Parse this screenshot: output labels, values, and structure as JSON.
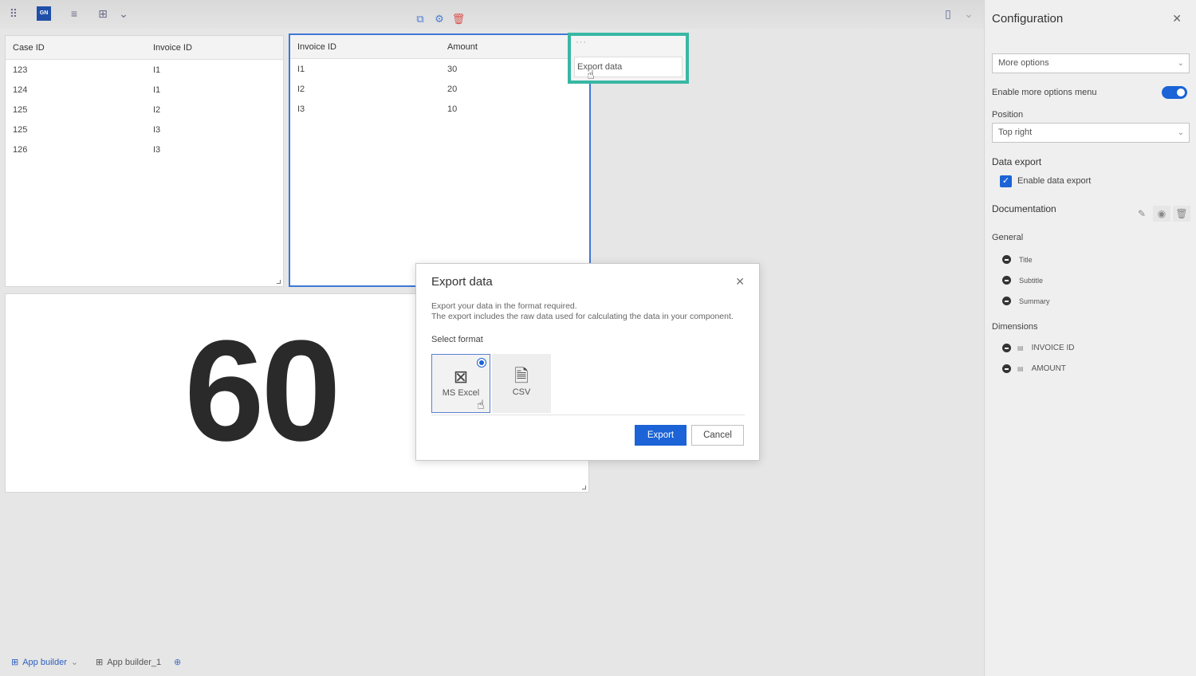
{
  "toolbar": {
    "badge_text": "GN"
  },
  "table1": {
    "headers": [
      "Case ID",
      "Invoice ID"
    ],
    "rows": [
      [
        "123",
        "I1"
      ],
      [
        "124",
        "I1"
      ],
      [
        "125",
        "I2"
      ],
      [
        "125",
        "I3"
      ],
      [
        "126",
        "I3"
      ]
    ]
  },
  "table2": {
    "headers": [
      "Invoice ID",
      "Amount"
    ],
    "rows": [
      [
        "I1",
        "30"
      ],
      [
        "I2",
        "20"
      ],
      [
        "I3",
        "10"
      ]
    ]
  },
  "more_menu": {
    "dots": "···",
    "export_item": "Export data"
  },
  "kpi": {
    "value": "60"
  },
  "modal": {
    "title": "Export data",
    "close": "✕",
    "description_line1": "Export your data in the format required.",
    "description_line2": "The export includes the raw data used for calculating the data in your component.",
    "select_format_label": "Select format",
    "formats": [
      {
        "label": "MS Excel",
        "icon": "excel-icon",
        "selected": true
      },
      {
        "label": "CSV",
        "icon": "csv-icon",
        "selected": false
      }
    ],
    "export_label": "Export",
    "cancel_label": "Cancel"
  },
  "config": {
    "title": "Configuration",
    "close": "✕",
    "section_select": "More options",
    "enable_more_options": "Enable more options menu",
    "position_label": "Position",
    "position_value": "Top right",
    "data_export_heading": "Data export",
    "enable_data_export": "Enable data export",
    "documentation_heading": "Documentation",
    "general_heading": "General",
    "general_items": [
      "Title",
      "Subtitle",
      "Summary"
    ],
    "dimensions_heading": "Dimensions",
    "dimension_items": [
      "INVOICE ID",
      "AMOUNT"
    ]
  },
  "bottom_tabs": {
    "tab1": "App builder",
    "tab2": "App builder_1"
  },
  "colors": {
    "accent": "#1b63d6",
    "highlight": "#38b7a4"
  }
}
